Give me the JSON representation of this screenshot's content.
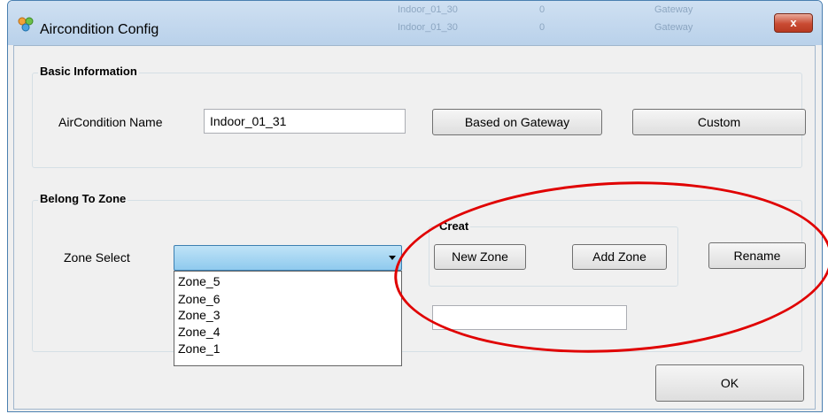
{
  "window": {
    "title": "Aircondition Config",
    "close_label": "x",
    "background_rows": [
      {
        "name": "Indoor_01_30",
        "value": "0",
        "extra": "Gateway"
      },
      {
        "name": "Indoor_01_30",
        "value": "0",
        "extra": "Gateway"
      }
    ]
  },
  "basic_info": {
    "group_title": "Basic Information",
    "name_label": "AirCondition Name",
    "name_value": "Indoor_01_31",
    "based_on_gateway_label": "Based on Gateway",
    "custom_label": "Custom"
  },
  "zone": {
    "group_title": "Belong To Zone",
    "select_label": "Zone Select",
    "selected_value": "",
    "options": [
      "Zone_5",
      "Zone_6",
      "Zone_3",
      "Zone_4",
      "Zone_1"
    ],
    "creat_title": "Creat",
    "new_zone_label": "New Zone",
    "add_zone_label": "Add Zone",
    "rename_label": "Rename",
    "new_zone_name_value": ""
  },
  "footer": {
    "ok_label": "OK"
  },
  "colors": {
    "annotation_circle": "#e00000",
    "title_bar": "#b9d1ea",
    "combo_fill": "#8fcaee"
  },
  "icons": {
    "app": "aircondition-app-icon",
    "close": "close-icon",
    "dropdown": "chevron-down-icon"
  }
}
